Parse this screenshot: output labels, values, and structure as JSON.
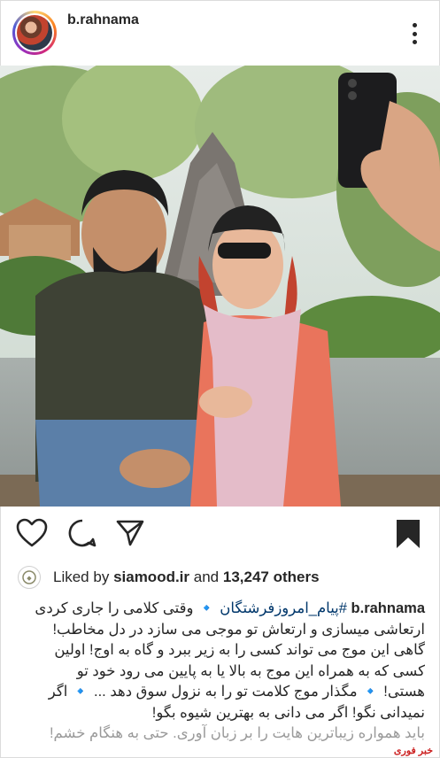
{
  "post": {
    "username": "b.rahnama",
    "more_icon": "more-vertical-icon"
  },
  "actions": {
    "like_icon": "heart-icon",
    "comment_icon": "comment-icon",
    "share_icon": "send-icon",
    "save_icon": "bookmark-icon"
  },
  "likes": {
    "prefix": "Liked by",
    "liker": "siamood.ir",
    "middle": "and",
    "count": "13,247 others"
  },
  "caption": {
    "username": "b.rahnama",
    "hashtag": "#پیام_امروزفرشتگان",
    "line1": "وقتی کلامی را جاری کردی",
    "line2": "ارتعاشی میسازی و ارتعاش تو موجی می سازد در دل مخاطب!",
    "line3": "گاهی این موج می تواند کسی را به زیر ببرد و گاه به اوج! اولین",
    "line4": "کسی که به همراه این موج به بالا یا به پایین می رود خود تو",
    "line5": "هستی! 🔹 مگذار موج کلامت تو را به نزول سوق دهد ... 🔹 اگر",
    "line6": "نمیدانی نگو! اگر می دانی به بهترین شیوه بگو!",
    "line7": "باید همواره زیباترین هایت را بر زبان آوری. حتی به هنگام خشم!"
  },
  "watermark": "خبر فوری"
}
